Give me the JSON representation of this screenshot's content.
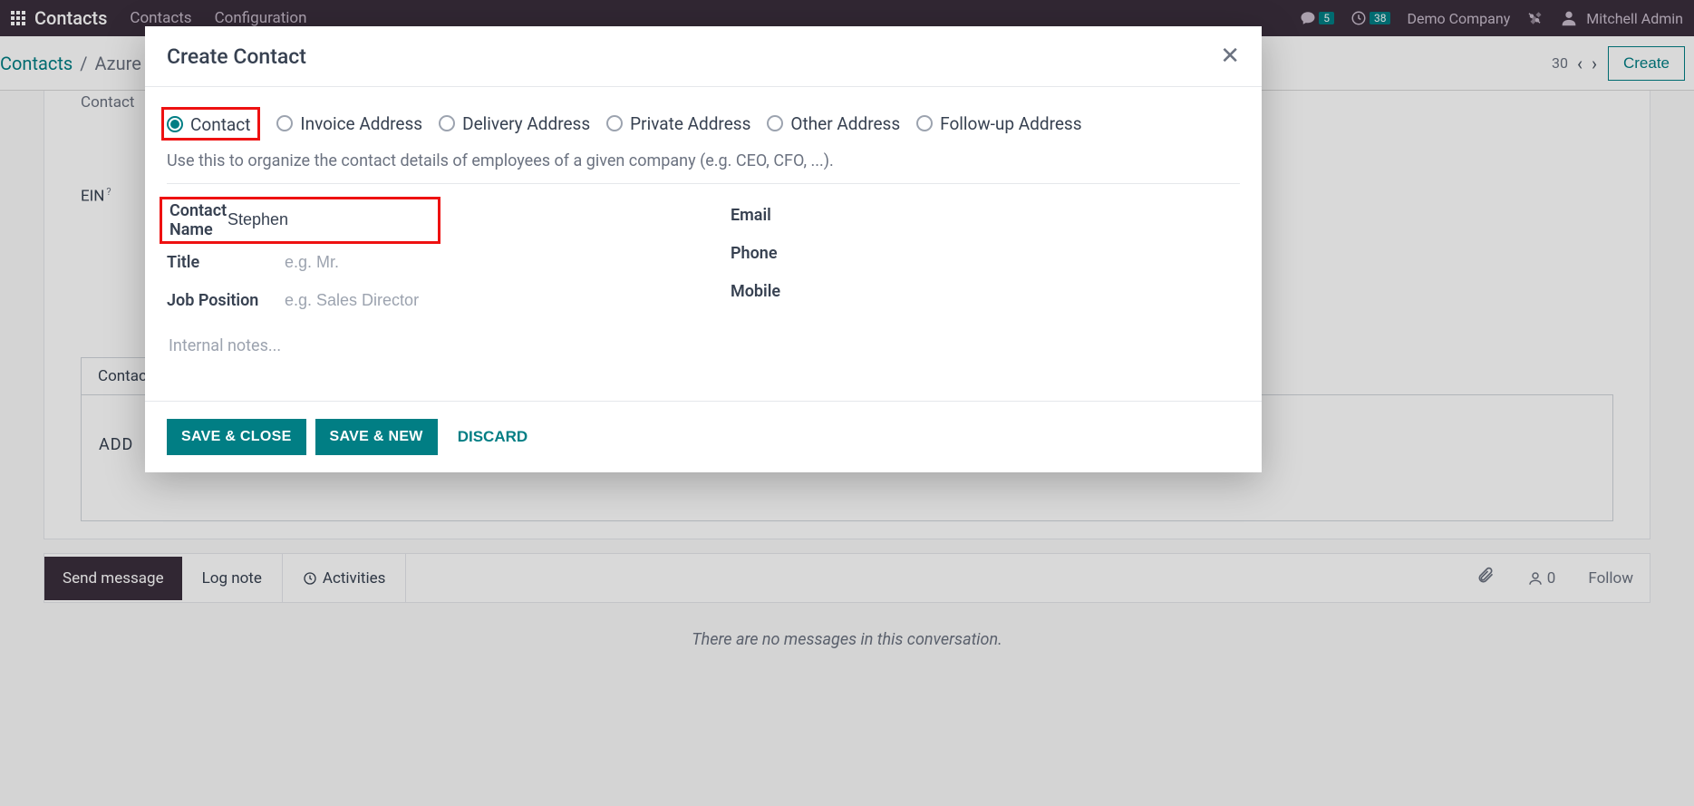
{
  "top_nav": {
    "app_name": "Contacts",
    "menu": [
      "Contacts",
      "Configuration"
    ],
    "msg_badge": "5",
    "clock_badge": "38",
    "company": "Demo Company",
    "user": "Mitchell Admin"
  },
  "breadcrumb": {
    "root": "Contacts",
    "current": "Azure",
    "pager_end": "30",
    "create": "Create"
  },
  "bg_form": {
    "contact_label": "Contact",
    "ein_label": "EIN",
    "tab_label": "Contact",
    "add_label": "ADD"
  },
  "chatter": {
    "send_message": "Send message",
    "log_note": "Log note",
    "activities": "Activities",
    "followers_count": "0",
    "follow": "Follow",
    "empty": "There are no messages in this conversation."
  },
  "modal": {
    "title": "Create Contact",
    "radios": [
      "Contact",
      "Invoice Address",
      "Delivery Address",
      "Private Address",
      "Other Address",
      "Follow-up Address"
    ],
    "selected_radio_index": 0,
    "hint": "Use this to organize the contact details of employees of a given company (e.g. CEO, CFO, ...).",
    "fields": {
      "contact_name_label": "Contact Name",
      "contact_name_value": "Stephen",
      "title_label": "Title",
      "title_placeholder": "e.g. Mr.",
      "job_position_label": "Job Position",
      "job_position_placeholder": "e.g. Sales Director",
      "email_label": "Email",
      "phone_label": "Phone",
      "mobile_label": "Mobile",
      "internal_notes_placeholder": "Internal notes..."
    },
    "buttons": {
      "save_close": "SAVE & CLOSE",
      "save_new": "SAVE & NEW",
      "discard": "DISCARD"
    }
  }
}
